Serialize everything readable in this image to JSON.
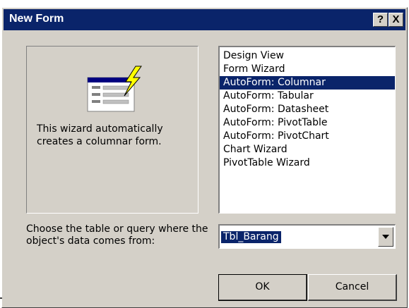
{
  "dialog": {
    "title": "New Form",
    "help_label": "?",
    "close_label": "X"
  },
  "preview": {
    "description": "This wizard automatically creates a columnar form.",
    "icon": "form-wizard-icon"
  },
  "list": {
    "items": [
      "Design View",
      "Form Wizard",
      "AutoForm:  Columnar",
      "AutoForm:  Tabular",
      "AutoForm:  Datasheet",
      "AutoForm:  PivotTable",
      "AutoForm:  PivotChart",
      "Chart Wizard",
      "PivotTable Wizard"
    ],
    "selected_index": 2
  },
  "source": {
    "label": "Choose the table or query where the object's data comes from:",
    "value": "Tbl_Barang"
  },
  "buttons": {
    "ok": "OK",
    "cancel": "Cancel"
  },
  "colors": {
    "title_bar": "#0a246a",
    "dialog_face": "#d4d0c8",
    "selection": "#0a246a"
  }
}
